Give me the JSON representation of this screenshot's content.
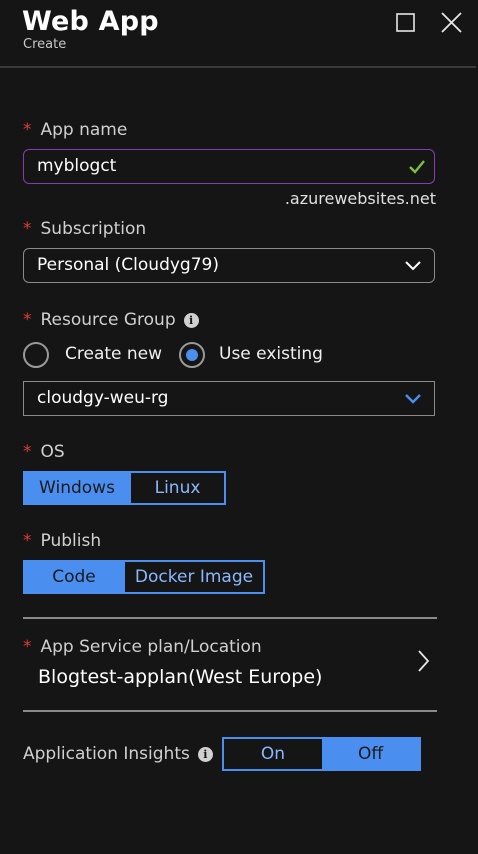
{
  "header": {
    "title": "Web App",
    "subtitle": "Create"
  },
  "app_name": {
    "label": "App name",
    "value": "myblogct",
    "suffix": ".azurewebsites.net",
    "valid": true
  },
  "subscription": {
    "label": "Subscription",
    "value": "Personal (Cloudyg79)"
  },
  "resource_group": {
    "label": "Resource Group",
    "option_create": "Create new",
    "option_existing": "Use existing",
    "selected": "Use existing",
    "value": "cloudgy-weu-rg"
  },
  "os": {
    "label": "OS",
    "options": [
      "Windows",
      "Linux"
    ],
    "selected": "Windows"
  },
  "publish": {
    "label": "Publish",
    "options": [
      "Code",
      "Docker Image"
    ],
    "selected": "Code"
  },
  "service_plan": {
    "label": "App Service plan/Location",
    "value": "Blogtest-applan(West Europe)"
  },
  "app_insights": {
    "label": "Application Insights",
    "options": [
      "On",
      "Off"
    ],
    "selected": "Off"
  },
  "required_marker": "*",
  "colors": {
    "background": "#151515",
    "accent": "#4a8ef0",
    "required": "#e03c3c",
    "valid_check": "#7fbf3f",
    "focus_border": "#8a3ab0"
  }
}
